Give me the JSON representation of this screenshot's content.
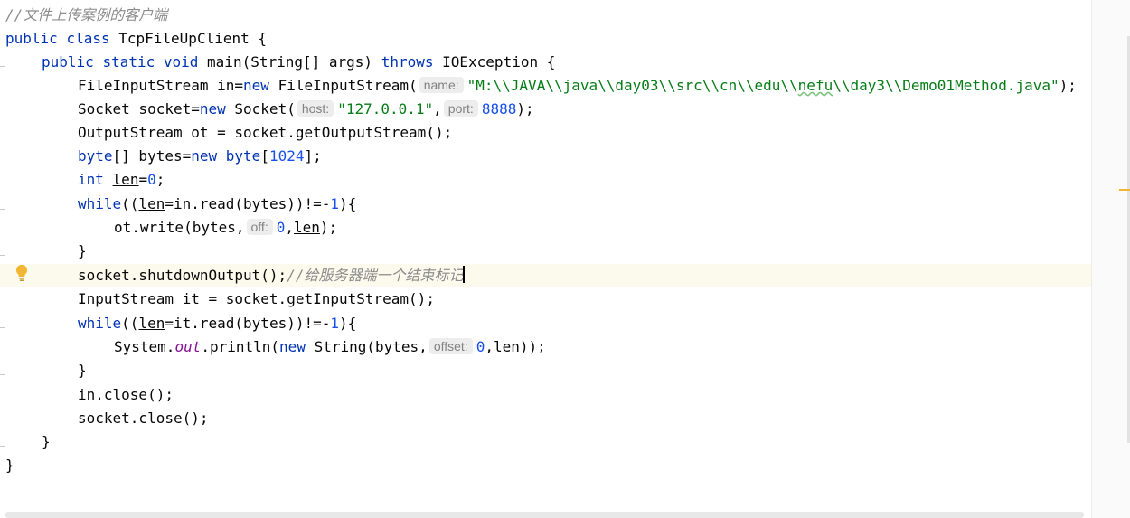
{
  "editor": {
    "hints": {
      "name": "name:",
      "host": "host:",
      "port": "port:",
      "off": "off:",
      "offset": "offset:"
    },
    "lines": {
      "l1": {
        "comment": "//文件上传案例的客户端"
      },
      "l2": {
        "kw1": "public",
        "kw2": "class",
        "rest": " TcpFileUpClient {"
      },
      "l3": {
        "kw1": "public",
        "kw2": "static",
        "kw3": "void",
        "mid": " main(String[] args) ",
        "kw4": "throws",
        "rest": " IOException {"
      },
      "l4": {
        "a": "FileInputStream in=",
        "kw": "new",
        "b": " FileInputStream(",
        "s1": "\"M:\\\\JAVA\\\\java\\\\day03\\\\src\\\\cn\\\\edu\\\\",
        "s2": "nefu",
        "s3": "\\\\day3\\\\Demo01Method.java\"",
        "c": ");"
      },
      "l5": {
        "a": "Socket socket=",
        "kw": "new",
        "b": " Socket(",
        "s": "\"127.0.0.1\"",
        "comma": ",",
        "n": "8888",
        "c": ");"
      },
      "l6": {
        "text": "OutputStream ot = socket.getOutputStream();"
      },
      "l7": {
        "kw1": "byte",
        "a": "[] bytes=",
        "kw2": "new",
        "sp": " ",
        "kw3": "byte",
        "b": "[",
        "n": "1024",
        "c": "];"
      },
      "l8": {
        "kw": "int",
        "sp": " ",
        "v": "len",
        "eq": "=",
        "n": "0",
        "c": ";"
      },
      "l9": {
        "kw": "while",
        "a": "((",
        "v": "len",
        "b": "=in.read(bytes))!=-",
        "n": "1",
        "c": "){"
      },
      "l10": {
        "a": "ot.write(bytes,",
        "n": "0",
        "comma": ",",
        "v": "len",
        "c": ");"
      },
      "l11": {
        "text": "}"
      },
      "l12": {
        "a": "socket.shutdownOutput();",
        "comment": "//给服务器端一个结束标记"
      },
      "l13": {
        "text": "InputStream it = socket.getInputStream();"
      },
      "l14": {
        "kw": "while",
        "a": "((",
        "v": "len",
        "b": "=it.read(bytes))!=-",
        "n": "1",
        "c": "){"
      },
      "l15": {
        "a": "System.",
        "f": "out",
        "b": ".println(",
        "kw": "new",
        "c": " String(bytes,",
        "n": "0",
        "comma": ",",
        "v": "len",
        "d": "));"
      },
      "l16": {
        "text": "}"
      },
      "l17": {
        "text": "in.close();"
      },
      "l18": {
        "text": "socket.close();"
      },
      "l19": {
        "text": "}"
      },
      "l20": {
        "text": "}"
      }
    }
  },
  "colors": {
    "keyword": "#0033b3",
    "string": "#067d17",
    "number": "#1750eb",
    "comment": "#8c8c8c",
    "static_field": "#871094",
    "current_line": "#fcfaed",
    "bulb": "#f2b632"
  },
  "icons": {
    "intention": "lightbulb-icon",
    "fold": "fold-marker-icon"
  }
}
